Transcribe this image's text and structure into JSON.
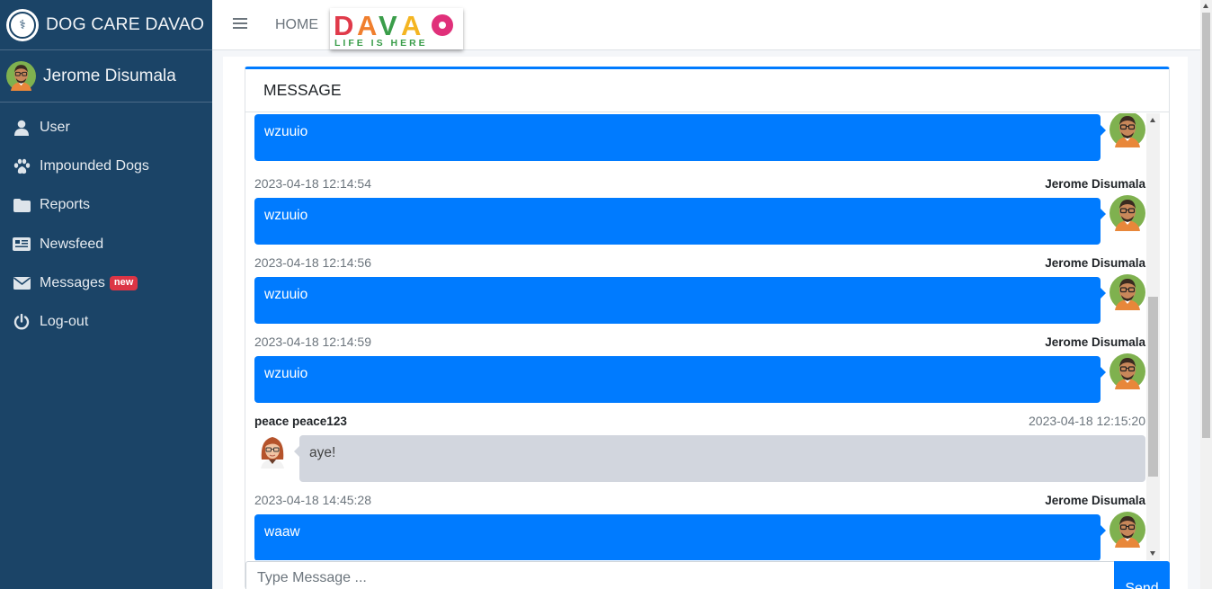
{
  "brand": {
    "title": "DOG CARE DAVAO"
  },
  "user": {
    "name": "Jerome Disumala"
  },
  "sidebar": {
    "items": [
      {
        "label": "User",
        "icon": "user-icon"
      },
      {
        "label": "Impounded Dogs",
        "icon": "paw-icon"
      },
      {
        "label": "Reports",
        "icon": "folder-icon"
      },
      {
        "label": "Newsfeed",
        "icon": "newspaper-icon"
      },
      {
        "label": "Messages",
        "icon": "envelope-icon",
        "badge": "new"
      },
      {
        "label": "Log-out",
        "icon": "power-icon"
      }
    ]
  },
  "topbar": {
    "home_label": "HOME",
    "logo_text": "DAVAO",
    "logo_tagline": "LIFE IS HERE"
  },
  "card": {
    "title": "MESSAGE"
  },
  "messages": [
    {
      "side": "right",
      "text": "wzuuio"
    },
    {
      "side": "right",
      "name": "Jerome Disumala",
      "time": "2023-04-18 12:14:54",
      "text": "wzuuio"
    },
    {
      "side": "right",
      "name": "Jerome Disumala",
      "time": "2023-04-18 12:14:56",
      "text": "wzuuio"
    },
    {
      "side": "right",
      "name": "Jerome Disumala",
      "time": "2023-04-18 12:14:59",
      "text": "wzuuio"
    },
    {
      "side": "left",
      "name": "peace peace123",
      "time": "2023-04-18 12:15:20",
      "text": "aye!"
    },
    {
      "side": "right",
      "name": "Jerome Disumala",
      "time": "2023-04-18 14:45:28",
      "text": "waaw"
    }
  ],
  "composer": {
    "placeholder": "Type Message ...",
    "send_label": "Send"
  },
  "colors": {
    "sidebar": "#1b4467",
    "primary": "#007bff",
    "received_bubble": "#d2d6de",
    "badge": "#dc3545"
  }
}
